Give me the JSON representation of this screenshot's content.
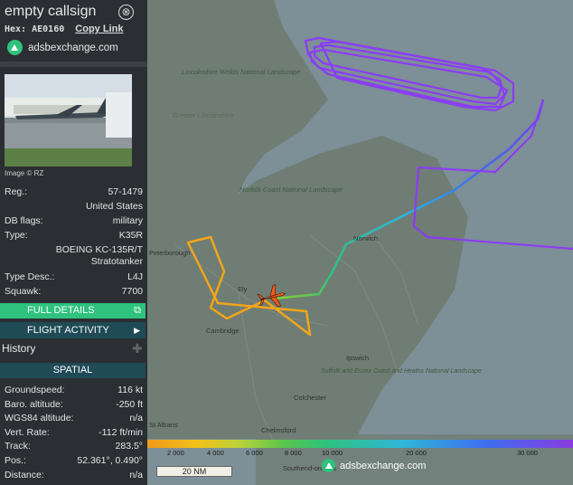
{
  "header": {
    "title": "empty callsign",
    "close_label": "⊗",
    "hex_prefix": "Hex:",
    "hex": "AE0160",
    "copy_link": "Copy Link"
  },
  "brand": {
    "name": "adsbexchange.com",
    "color": "#2ec27e"
  },
  "photo": {
    "credit": "Image © RZ"
  },
  "aircraft": [
    {
      "k": "Reg.:",
      "v": "57-1479"
    },
    {
      "k": "",
      "v": "United States"
    },
    {
      "k": "DB flags:",
      "v": "military"
    },
    {
      "k": "Type:",
      "v": "K35R"
    },
    {
      "k": "",
      "v": "BOEING KC-135R/T Stratotanker"
    },
    {
      "k": "Type Desc.:",
      "v": "L4J"
    },
    {
      "k": "Squawk:",
      "v": "7700"
    }
  ],
  "buttons": {
    "full_details": "FULL DETAILS",
    "flight_activity": "FLIGHT ACTIVITY",
    "history": "History",
    "spatial": "SPATIAL"
  },
  "spatial": [
    {
      "k": "Groundspeed:",
      "v": "116 kt"
    },
    {
      "k": "Baro. altitude:",
      "v": "-250 ft"
    },
    {
      "k": "WGS84 altitude:",
      "v": "n/a"
    },
    {
      "k": "Vert. Rate:",
      "v": "-112 ft/min"
    },
    {
      "k": "Track:",
      "v": "283.5°"
    },
    {
      "k": "Pos.:",
      "v": "52.361°, 0.490°"
    },
    {
      "k": "Distance:",
      "v": "n/a"
    }
  ],
  "map": {
    "scale": "20 NM",
    "logo_text": "adsbexchange.com",
    "place_labels": [
      "Lincolnshire Wolds National Landscape",
      "Greater Lincolnshire",
      "Norfolk Coast National Landscape",
      "Norwich",
      "Peterborough",
      "Ely",
      "Cambridge",
      "Ipswich",
      "Suffolk and Essex Coast and Heaths National Landscape",
      "Colchester",
      "Chelmsford",
      "St Albans",
      "Southend-on-Sea"
    ],
    "altitude_legend": [
      "2 000",
      "4 000",
      "6 000",
      "8 000",
      "10 000",
      "20 000",
      "30 000"
    ]
  }
}
